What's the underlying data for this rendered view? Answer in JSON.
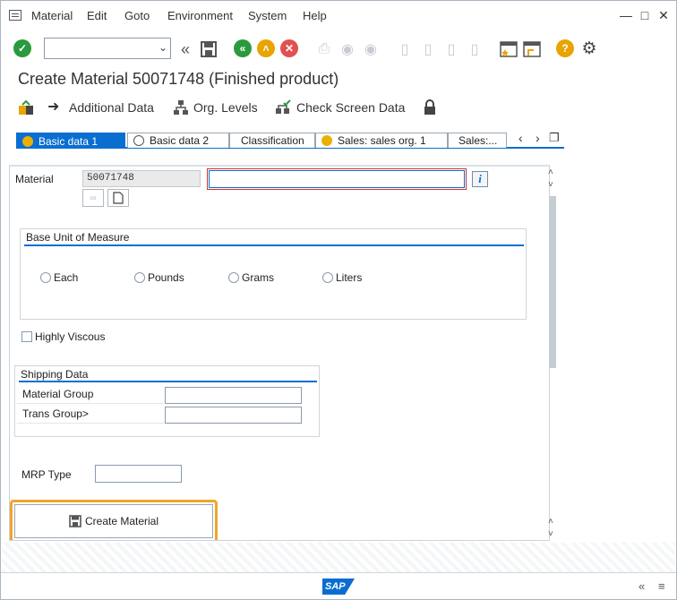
{
  "menubar": {
    "items": [
      "Material",
      "Edit",
      "Goto",
      "Environment",
      "System",
      "Help"
    ],
    "window_controls": [
      "minimize-icon",
      "maximize-icon",
      "close-icon"
    ]
  },
  "toolbar": {
    "command_field": {
      "value": "",
      "placeholder": ""
    }
  },
  "screen_title": "Create Material 50071748 (Finished product)",
  "app_toolbar": {
    "additional_data": "Additional Data",
    "org_levels": "Org. Levels",
    "check_screen_data": "Check Screen Data"
  },
  "tabs": [
    {
      "label": "Basic data 1"
    },
    {
      "label": "Basic data 2"
    },
    {
      "label": "Classification"
    },
    {
      "label": "Sales: sales org. 1"
    },
    {
      "label": "Sales:..."
    }
  ],
  "form": {
    "material_label": "Material",
    "material_number": "50071748",
    "material_description": "",
    "base_uom_title": "Base Unit of Measure",
    "uom_options": [
      "Each",
      "Pounds",
      "Grams",
      "Liters"
    ],
    "highly_viscous_label": "Highly Viscous",
    "shipping_title": "Shipping Data",
    "material_group_label": "Material Group",
    "material_group_value": "",
    "trans_group_label": "Trans Group>",
    "trans_group_value": "",
    "mrp_type_label": "MRP Type",
    "mrp_type_value": "",
    "create_button": "Create Material"
  },
  "colors": {
    "accent": "#0a6ed1",
    "highlight": "#f0a52b",
    "enter_green": "#2b9a3f",
    "back_green": "#2b9a3f",
    "exit_orange": "#e8a400",
    "cancel_red": "#e05252"
  },
  "status_bar": {
    "logo_text": "SAP"
  }
}
